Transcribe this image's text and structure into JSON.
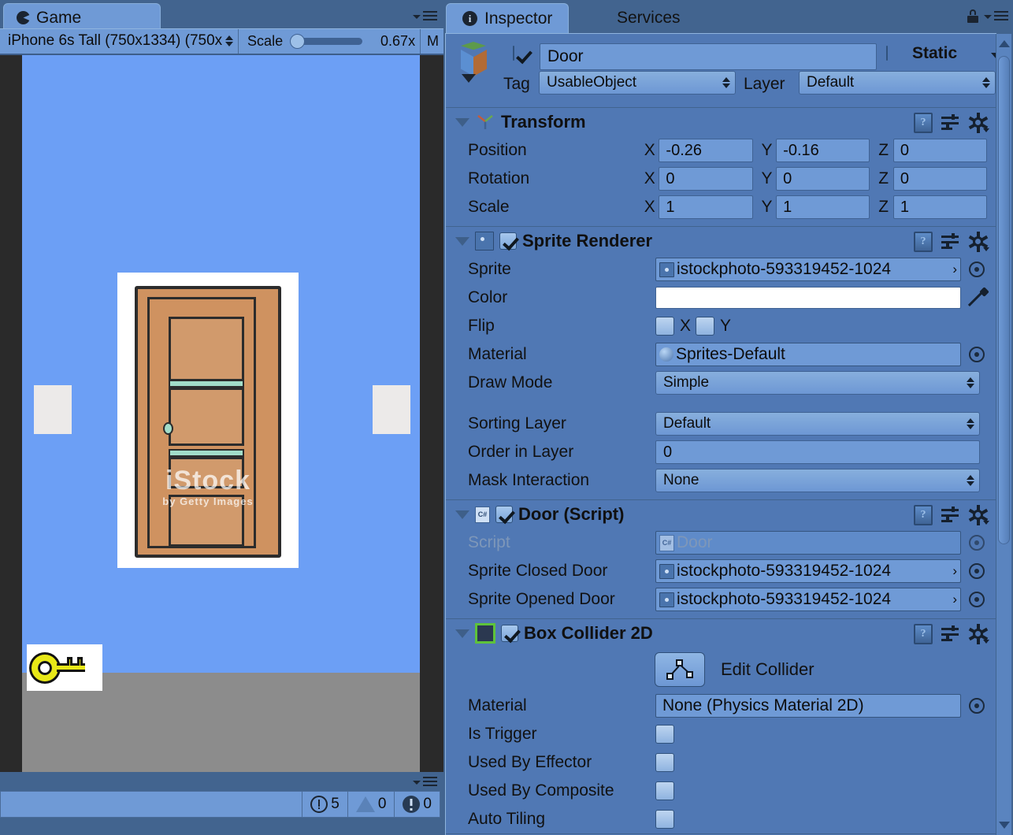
{
  "game_panel": {
    "tab_label": "Game",
    "tab_icon": "unity-game-icon",
    "toolbar": {
      "aspect_value": "iPhone 6s Tall (750x1334) (750x",
      "scale_label": "Scale",
      "scale_value": "0.67x",
      "maximize_label": "M"
    },
    "status": {
      "errors": "5",
      "warnings": "0",
      "logs": "0"
    },
    "scene": {
      "sky_color": "#6c9ff5",
      "floor_color": "#8c8c8c",
      "door_sprite_name": "door",
      "key_sprite_name": "key",
      "watermark_big": "iStock",
      "watermark_small": "by Getty Images"
    }
  },
  "inspector": {
    "tabs": [
      {
        "label": "Inspector",
        "active": true
      },
      {
        "label": "Services",
        "active": false
      }
    ],
    "game_object": {
      "enabled": true,
      "name": "Door",
      "static_label": "Static",
      "static_checked": false,
      "tag_label": "Tag",
      "tag_value": "UsableObject",
      "layer_label": "Layer",
      "layer_value": "Default"
    },
    "components": [
      {
        "title": "Transform",
        "icon": "transform-axis-icon",
        "has_enable_toggle": false,
        "rows": [
          {
            "label": "Position",
            "x": "-0.26",
            "y": "-0.16",
            "z": "0"
          },
          {
            "label": "Rotation",
            "x": "0",
            "y": "0",
            "z": "0"
          },
          {
            "label": "Scale",
            "x": "1",
            "y": "1",
            "z": "1"
          }
        ],
        "axis_labels": {
          "x": "X",
          "y": "Y",
          "z": "Z"
        }
      },
      {
        "title": "Sprite Renderer",
        "icon": "sprite-renderer-icon",
        "enabled": true,
        "sprite_label": "Sprite",
        "sprite_value": "istockphoto-593319452-1024",
        "color_label": "Color",
        "color_value": "#FFFFFF",
        "flip_label": "Flip",
        "flip_x_label": "X",
        "flip_y_label": "Y",
        "flip_x": false,
        "flip_y": false,
        "material_label": "Material",
        "material_value": "Sprites-Default",
        "draw_mode_label": "Draw Mode",
        "draw_mode_value": "Simple",
        "sorting_layer_label": "Sorting Layer",
        "sorting_layer_value": "Default",
        "order_in_layer_label": "Order in Layer",
        "order_in_layer_value": "0",
        "mask_interaction_label": "Mask Interaction",
        "mask_interaction_value": "None"
      },
      {
        "title": "Door (Script)",
        "icon": "csharp-script-icon",
        "enabled": true,
        "script_label": "Script",
        "script_value": "Door",
        "sprite_closed_label": "Sprite Closed Door",
        "sprite_closed_value": "istockphoto-593319452-1024",
        "sprite_opened_label": "Sprite Opened Door",
        "sprite_opened_value": "istockphoto-593319452-1024"
      },
      {
        "title": "Box Collider 2D",
        "icon": "box-collider-2d-icon",
        "enabled": true,
        "edit_collider_label": "Edit Collider",
        "material_label": "Material",
        "material_value": "None (Physics Material 2D)",
        "is_trigger_label": "Is Trigger",
        "is_trigger": false,
        "used_by_effector_label": "Used By Effector",
        "used_by_effector": false,
        "used_by_composite_label": "Used By Composite",
        "used_by_composite": false,
        "auto_tiling_label": "Auto Tiling",
        "auto_tiling": false
      }
    ],
    "overflow_arrow": "›"
  },
  "colors": {
    "panel_bg": "#5078b4",
    "chrome_bg": "#42648f",
    "field_bg": "#6f9ad6",
    "accent_green": "#5ec33a"
  }
}
